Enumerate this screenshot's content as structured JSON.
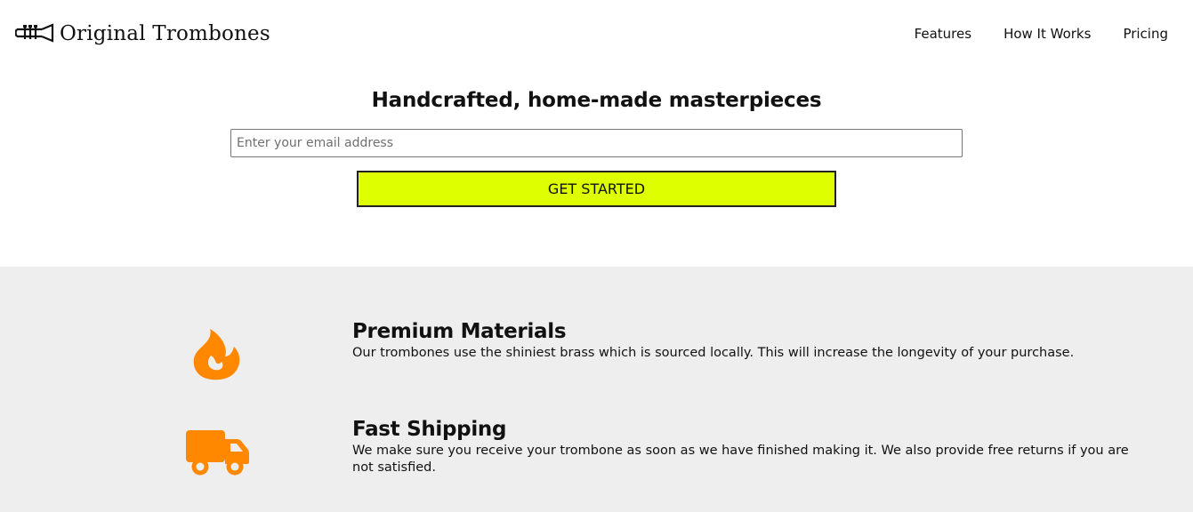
{
  "brand": {
    "name": "Original Trombones",
    "logo_icon": "trombone-icon"
  },
  "nav": {
    "items": [
      {
        "label": "Features"
      },
      {
        "label": "How It Works"
      },
      {
        "label": "Pricing"
      }
    ]
  },
  "hero": {
    "title": "Handcrafted, home-made masterpieces",
    "email_placeholder": "Enter your email address",
    "email_value": "",
    "cta_label": "GET STARTED"
  },
  "features": {
    "items": [
      {
        "icon": "fire-icon",
        "title": "Premium Materials",
        "description": "Our trombones use the shiniest brass which is sourced locally. This will increase the longevity of your purchase."
      },
      {
        "icon": "truck-icon",
        "title": "Fast Shipping",
        "description": "We make sure you receive your trombone as soon as we have finished making it. We also provide free returns if you are not satisfied."
      }
    ]
  },
  "colors": {
    "accent": "#ddff00",
    "icon": "#ff8800",
    "band_background": "#eeeeee"
  }
}
